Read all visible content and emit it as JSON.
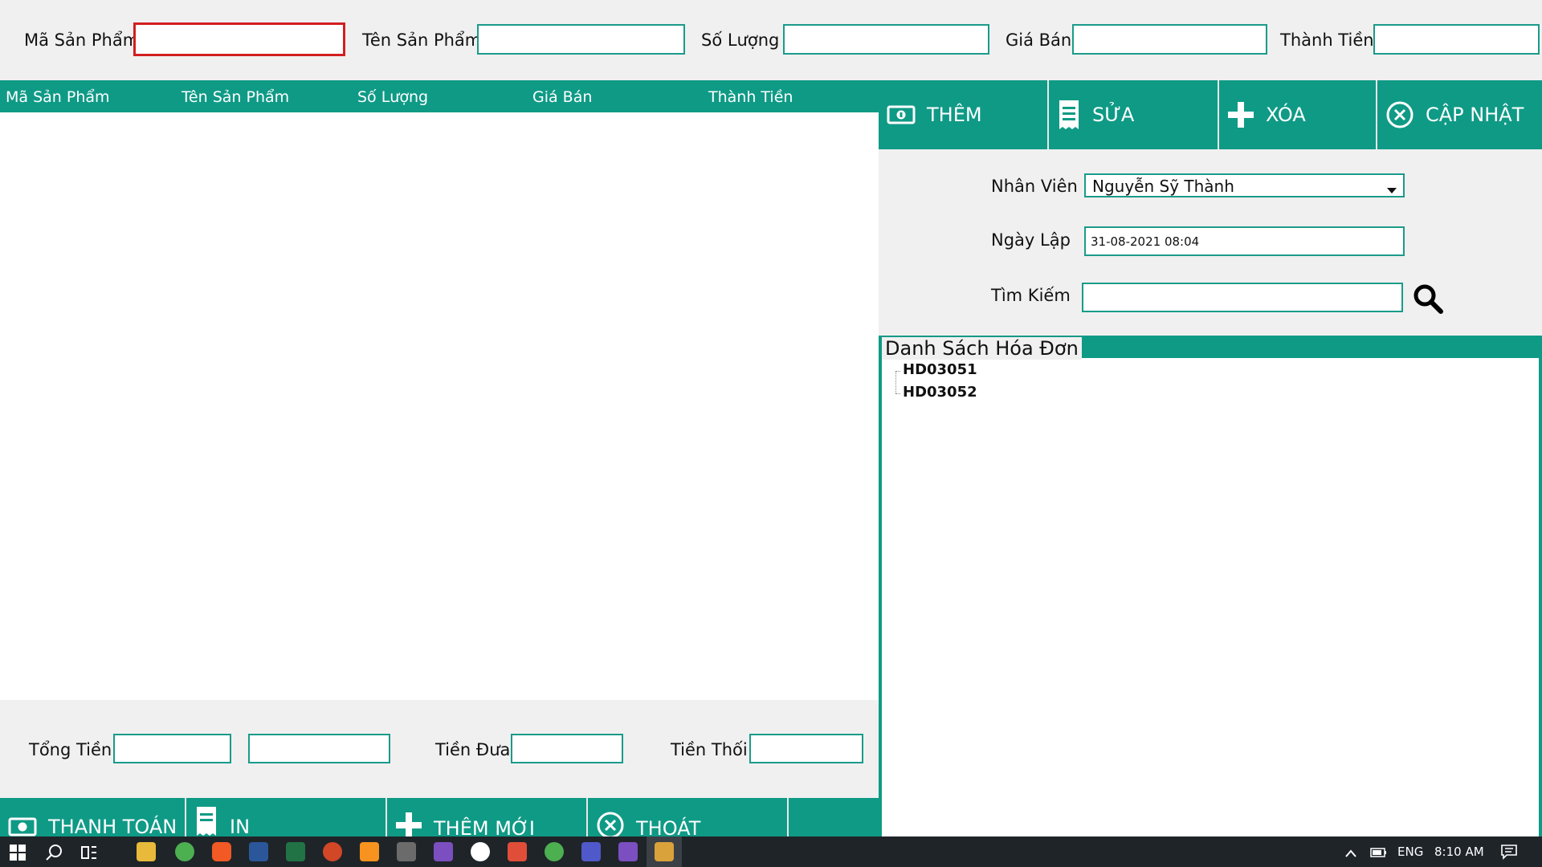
{
  "top_fields": {
    "ma_label": "Mã Sản Phẩm",
    "ten_label": "Tên Sản Phẩm",
    "so_luong_label": "Số Lượng",
    "gia_ban_label": "Giá Bán",
    "thanh_tien_label": "Thành Tiền",
    "ma_value": "",
    "ten_value": "",
    "so_luong_value": "",
    "gia_ban_value": "",
    "thanh_tien_value": ""
  },
  "table": {
    "columns": [
      "Mã Sản Phẩm",
      "Tên Sản Phẩm",
      "Số Lượng",
      "Giá Bán",
      "Thành Tiền"
    ],
    "rows": []
  },
  "actions": {
    "them": "THÊM",
    "sua": "SỬA",
    "xoa": "XÓA",
    "cap_nhat": "CẬP NHẬT"
  },
  "invoice_form": {
    "nhan_vien_label": "Nhân Viên",
    "nhan_vien_value": "Nguyễn Sỹ Thành",
    "ngay_lap_label": "Ngày Lập",
    "ngay_lap_value": "31-08-2021 08:04",
    "tim_kiem_label": "Tìm Kiếm",
    "tim_kiem_value": ""
  },
  "invoice_list": {
    "title": "Danh Sách Hóa Đơn",
    "items": [
      "HD03051",
      "HD03052"
    ]
  },
  "totals": {
    "tong_tien_label": "Tổng Tiền",
    "tien_dua_label": "Tiền Đưa",
    "tien_thoi_label": "Tiền Thối",
    "tong_tien_value": "",
    "tong_tien_value2": "",
    "tien_dua_value": "",
    "tien_thoi_value": ""
  },
  "bottom_actions": {
    "thanh_toan": "THANH TOÁN",
    "in": "IN",
    "them_moi": "THÊM MỚI",
    "thoat": "THOÁT"
  },
  "taskbar": {
    "language": "ENG",
    "time": "8:10 AM"
  },
  "colors": {
    "teal": "#0f9a86",
    "focus_border": "#d21f1f"
  }
}
